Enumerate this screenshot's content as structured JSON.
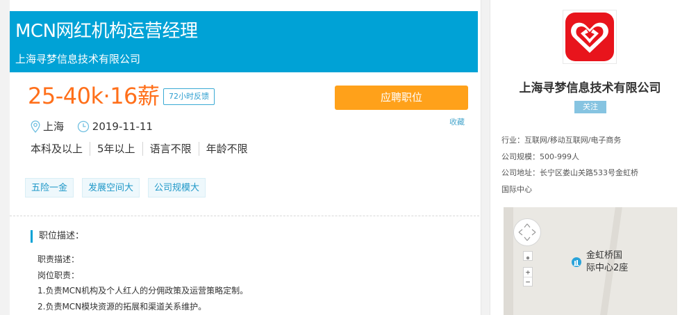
{
  "job": {
    "title": "MCN网红机构运营经理",
    "company": "上海寻梦信息技术有限公司",
    "salary": "25-40k·16薪",
    "feedback_badge": "72小时反馈",
    "apply_label": "应聘职位",
    "favorite_label": "收藏",
    "location": "上海",
    "date": "2019-11-11",
    "requirements": [
      "本科及以上",
      "5年以上",
      "语言不限",
      "年龄不限"
    ],
    "tags": [
      "五险一金",
      "发展空间大",
      "公司规模大"
    ],
    "description_heading": "职位描述：",
    "description_lines": [
      "职责描述：",
      "岗位职责：",
      "1.负责MCN机构及个人红人的分佣政策及运营策略定制。",
      "2.负责MCN模块资源的拓展和渠道关系维护。"
    ]
  },
  "company_panel": {
    "name": "上海寻梦信息技术有限公司",
    "follow_label": "关注",
    "industry": "行业：互联网/移动互联网/电子商务",
    "size": "公司规模：500-999人",
    "address_line1": "公司地址：长宁区娄山关路533号金虹桥",
    "address_line2": "国际中心"
  },
  "map": {
    "poi_line1": "金虹桥国",
    "poi_line2": "际中心2座",
    "zoom_in": "+",
    "zoom_out": "−"
  },
  "colors": {
    "accent": "#00a2d6",
    "salary": "#ff6f1a",
    "apply": "#ffa11a",
    "logo": "#e8141c"
  },
  "icons": {
    "location": "location-pin-icon",
    "date": "clock-icon",
    "logo": "company-logo-icon",
    "poi": "building-icon"
  }
}
